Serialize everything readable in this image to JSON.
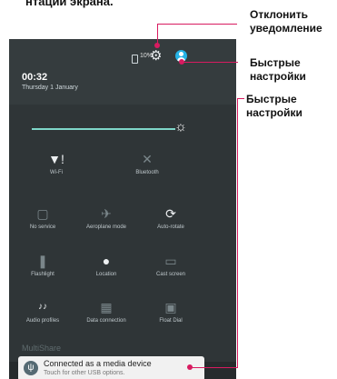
{
  "top_caption": "нтации экрана.",
  "status_bar": {
    "battery": "10%",
    "settings_icon": "gear-icon",
    "account_icon": "account-icon"
  },
  "header": {
    "time": "00:32",
    "date": "Thursday 1 January"
  },
  "tiles": [
    {
      "label": "Wi-Fi",
      "icon": "wifi-icon"
    },
    {
      "label": "Bluetooth",
      "icon": "bluetooth-icon"
    },
    {
      "label": "No service",
      "icon": "sim-icon"
    },
    {
      "label": "Aeroplane mode",
      "icon": "airplane-icon"
    },
    {
      "label": "Auto-rotate",
      "icon": "rotate-icon"
    },
    {
      "label": "Flashlight",
      "icon": "flashlight-icon"
    },
    {
      "label": "Location",
      "icon": "location-icon"
    },
    {
      "label": "Cast screen",
      "icon": "cast-icon"
    },
    {
      "label": "Audio profiles",
      "icon": "audio-profiles-icon"
    },
    {
      "label": "Data connection",
      "icon": "data-connection-icon"
    },
    {
      "label": "Float Dial",
      "icon": "float-dial-icon"
    }
  ],
  "background_app": "MultiShare",
  "notification": {
    "title": "Connected as a media device",
    "subtitle": "Touch for other USB options."
  },
  "annotations": {
    "dismiss": [
      "Отклонить",
      "уведомление"
    ],
    "quick1": [
      "Быстрые",
      "настройки"
    ],
    "quick2": [
      "Быстрые",
      "настройки"
    ]
  },
  "colors": {
    "annotation": "#d81b60",
    "accent": "#7fd6c9",
    "account": "#26b3e6"
  }
}
